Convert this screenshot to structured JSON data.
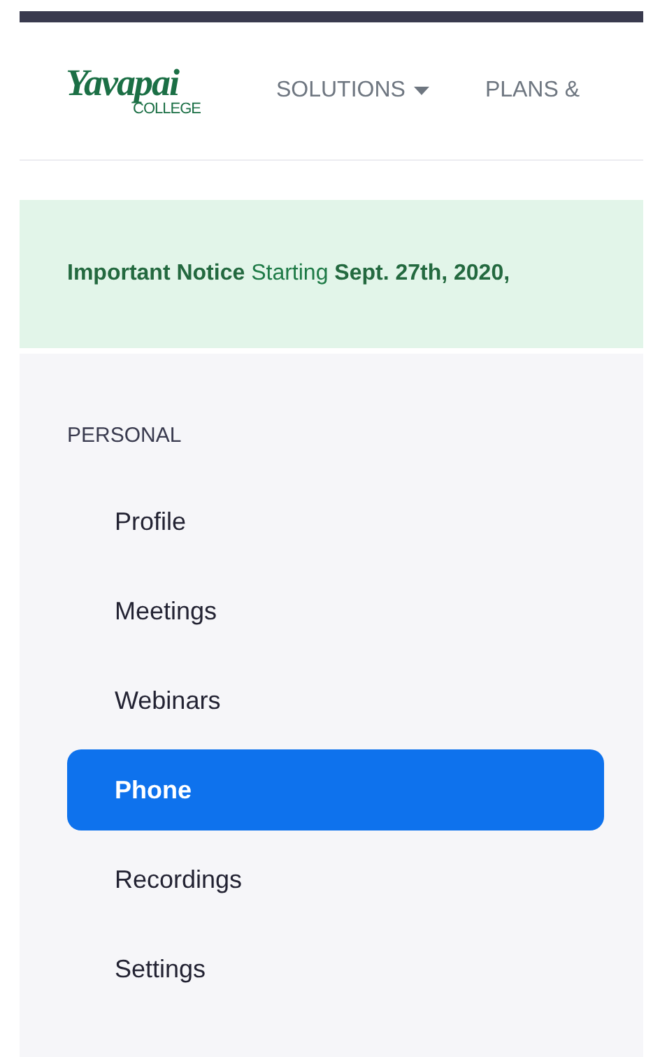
{
  "header": {
    "logo": {
      "name": "Yavapai",
      "subtitle": "COLLEGE"
    },
    "nav": [
      {
        "label": "SOLUTIONS",
        "dropdown": true
      },
      {
        "label": "PLANS &",
        "dropdown": false
      }
    ]
  },
  "notice": {
    "text": "**Important Notice** Starting **Sept. 27th, 2020,**"
  },
  "sidebar": {
    "section": "PERSONAL",
    "items": [
      {
        "label": "Profile",
        "selected": false
      },
      {
        "label": "Meetings",
        "selected": false
      },
      {
        "label": "Webinars",
        "selected": false
      },
      {
        "label": "Phone",
        "selected": true
      },
      {
        "label": "Recordings",
        "selected": false
      },
      {
        "label": "Settings",
        "selected": false
      }
    ]
  }
}
